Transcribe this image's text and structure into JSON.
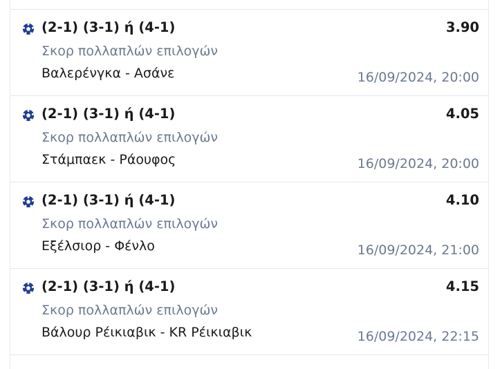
{
  "bets": [
    {
      "icon": "soccer-ball-icon",
      "selection": "(2-1) (3-1) ή (4-1)",
      "market": "Σκορ πολλαπλών επιλογών",
      "match": "Βαλερένγκα - Ασάνε",
      "date": "16/09/2024, 20:00",
      "odds": "3.90"
    },
    {
      "icon": "soccer-ball-icon",
      "selection": "(2-1) (3-1) ή (4-1)",
      "market": "Σκορ πολλαπλών επιλογών",
      "match": "Στάμπαεκ - Ράουφος",
      "date": "16/09/2024, 20:00",
      "odds": "4.05"
    },
    {
      "icon": "soccer-ball-icon",
      "selection": "(2-1) (3-1) ή (4-1)",
      "market": "Σκορ πολλαπλών επιλογών",
      "match": "Εξέλσιορ - Φένλο",
      "date": "16/09/2024, 21:00",
      "odds": "4.10"
    },
    {
      "icon": "soccer-ball-icon",
      "selection": "(2-1) (3-1) ή (4-1)",
      "market": "Σκορ πολλαπλών επιλογών",
      "match": "Βάλουρ Ρέικιαβικ - KR Ρέικιαβικ",
      "date": "16/09/2024, 22:15",
      "odds": "4.15"
    }
  ],
  "colors": {
    "primary_text": "#1a1a1a",
    "secondary_text": "#6b7a90",
    "divider": "#e3e6ec",
    "icon": "#1f3f8f"
  }
}
